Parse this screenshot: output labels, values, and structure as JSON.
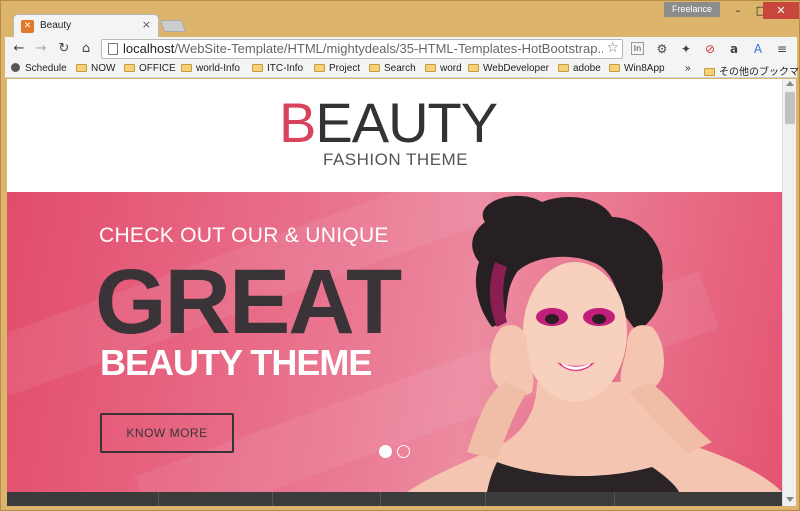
{
  "browser": {
    "tab_title": "Beauty",
    "tab_close": "×",
    "profile_label": "Freelance",
    "window_min": "–",
    "window_max": "□",
    "window_close": "✕",
    "url_host": "localhost",
    "url_path": "/WebSite-Template/HTML/mightydeals/35-HTML-Templates-HotBootstrap..."
  },
  "bookmarks": {
    "items": [
      {
        "label": "Schedule"
      },
      {
        "label": "NOW"
      },
      {
        "label": "OFFICE"
      },
      {
        "label": "world-Info"
      },
      {
        "label": "ITC-Info"
      },
      {
        "label": "Project"
      },
      {
        "label": "Search"
      },
      {
        "label": "word"
      },
      {
        "label": "WebDeveloper"
      },
      {
        "label": "adobe"
      },
      {
        "label": "Win8App"
      }
    ],
    "overflow": "»",
    "other": "その他のブックマーク"
  },
  "site": {
    "logo_first": "B",
    "logo_rest": "EAUTY",
    "logo_sub": "FASHION THEME"
  },
  "hero": {
    "eyebrow": "CHECK OUT OUR & UNIQUE",
    "headline": "GREAT",
    "subheadline": "BEAUTY THEME",
    "cta": "KNOW MORE"
  },
  "colors": {
    "accent": "#d9435e",
    "hero_pink": "#e24c6c",
    "dark_text": "#3a3438"
  }
}
